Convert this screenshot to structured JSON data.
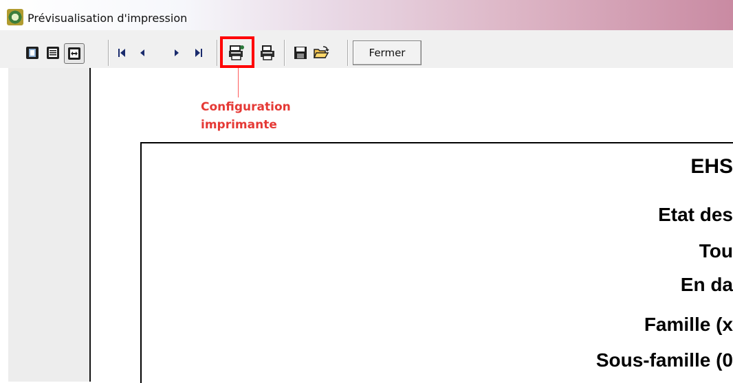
{
  "window": {
    "title": "Prévisualisation d'impression"
  },
  "toolbar": {
    "buttons": [
      {
        "name": "one-page-view-icon"
      },
      {
        "name": "page-list-view-icon"
      },
      {
        "name": "fit-width-icon"
      },
      {
        "name": "first-page-icon"
      },
      {
        "name": "previous-page-icon"
      },
      {
        "name": "next-page-icon"
      },
      {
        "name": "last-page-icon"
      },
      {
        "name": "printer-config-icon"
      },
      {
        "name": "print-icon"
      },
      {
        "name": "save-icon"
      },
      {
        "name": "open-icon"
      }
    ],
    "fermer_label": "Fermer"
  },
  "callout": {
    "line1": "Configuration",
    "line2": "imprimante",
    "color": "#e53935"
  },
  "report": {
    "title": "EHS",
    "line1": "Etat des",
    "line2": "Tou",
    "line3": "En da",
    "line4": "Famille (x",
    "line5": "Sous-famille (0"
  },
  "colors": {
    "highlight": "#ff0000"
  }
}
